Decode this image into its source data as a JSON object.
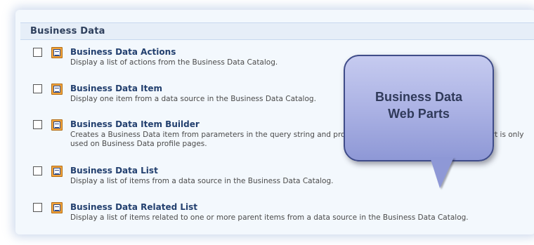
{
  "section": {
    "title": "Business Data"
  },
  "items": [
    {
      "title": "Business Data Actions",
      "description": "Display a list of actions from the Business Data Catalog."
    },
    {
      "title": "Business Data Item",
      "description": "Display one item from a data source in the Business Data Catalog."
    },
    {
      "title": "Business Data Item Builder",
      "description": "Creates a Business Data item from parameters in the query string and provides it to other web parts. This web part is only used on Business Data profile pages."
    },
    {
      "title": "Business Data List",
      "description": "Display a list of items from a data source in the Business Data Catalog."
    },
    {
      "title": "Business Data Related List",
      "description": "Display a list of items related to one or more parent items from a data source in the Business Data Catalog."
    }
  ],
  "callout": {
    "line1": "Business Data",
    "line2": "Web Parts"
  },
  "colors": {
    "header_bg": "#e6eef8",
    "title_text": "#23406f",
    "callout_fill": "#a9b0e3"
  },
  "icons": {
    "web_part": "web-part-icon"
  }
}
